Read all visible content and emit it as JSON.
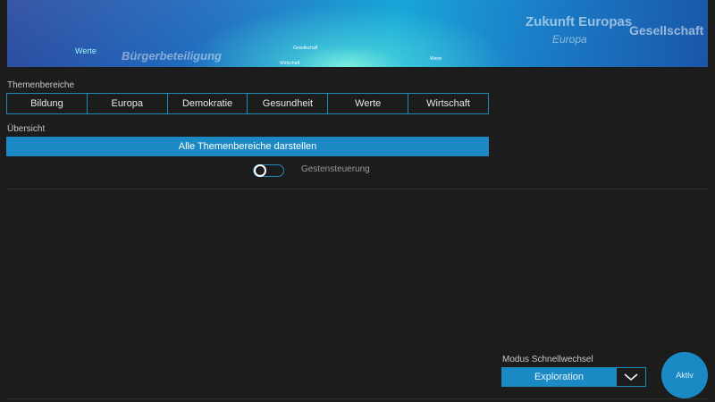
{
  "hero": {
    "words": [
      "Werte",
      "Bürgerbeteiligung",
      "Gesellschaft",
      "Wirtschaft",
      "Zukunft Europas",
      "Europa",
      "Gesellschaft",
      "Werte"
    ]
  },
  "themen": {
    "label": "Themenbereiche",
    "tabs": [
      "Bildung",
      "Europa",
      "Demokratie",
      "Gesundheit",
      "Werte",
      "Wirtschaft"
    ]
  },
  "uebersicht": {
    "label": "Übersicht",
    "button": "Alle Themenbereiche darstellen"
  },
  "gesten": {
    "label": "Gestensteuerung",
    "enabled": false
  },
  "mode": {
    "label": "Modus Schnellwechsel",
    "value": "Exploration"
  },
  "aktiv": {
    "label": "Aktiv"
  },
  "colors": {
    "accent": "#1b8ac4",
    "border": "#1e88b8",
    "background": "#1c1c1c"
  }
}
